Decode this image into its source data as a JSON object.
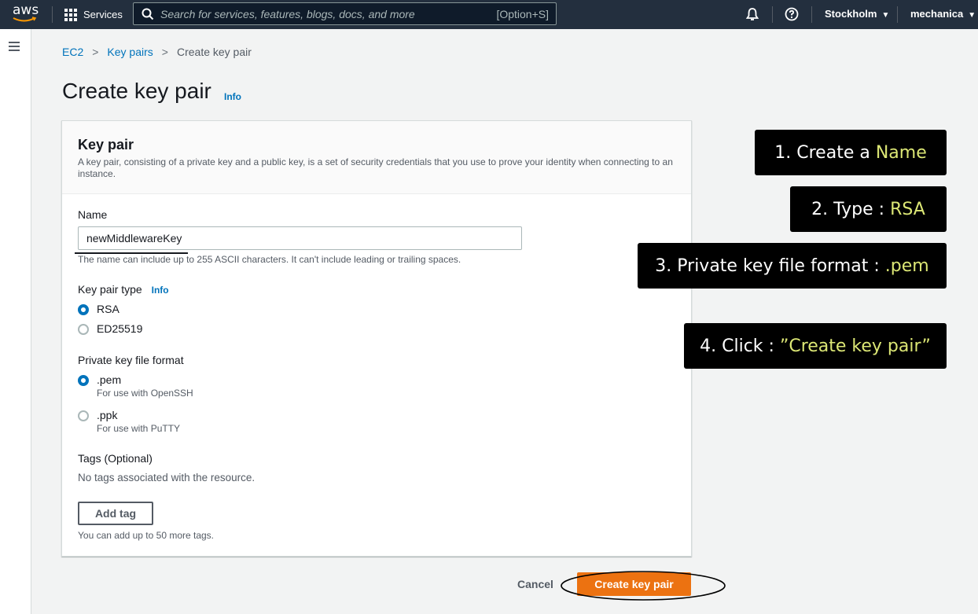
{
  "topnav": {
    "logo": "aws",
    "services_label": "Services",
    "search_placeholder": "Search for services, features, blogs, docs, and more",
    "search_shortcut": "[Option+S]",
    "region": "Stockholm",
    "account": "mechanica",
    "icons": [
      "grid-icon",
      "search-icon",
      "bell-icon",
      "help-icon",
      "caret-down-icon"
    ]
  },
  "breadcrumb": [
    "EC2",
    "Key pairs",
    "Create key pair"
  ],
  "page": {
    "title": "Create key pair",
    "info": "Info"
  },
  "panel": {
    "title": "Key pair",
    "description": "A key pair, consisting of a private key and a public key, is a set of security credentials that you use to prove your identity when connecting to an instance.",
    "name_label": "Name",
    "name_value": "newMiddlewareKey",
    "name_hint": "The name can include up to 255 ASCII characters. It can't include leading or trailing spaces.",
    "type_label": "Key pair type",
    "type_info": "Info",
    "type_options": [
      {
        "label": "RSA",
        "selected": true
      },
      {
        "label": "ED25519",
        "selected": false
      }
    ],
    "format_label": "Private key file format",
    "format_options": [
      {
        "label": ".pem",
        "sub": "For use with OpenSSH",
        "selected": true
      },
      {
        "label": ".ppk",
        "sub": "For use with PuTTY",
        "selected": false
      }
    ],
    "tags_label": "Tags (Optional)",
    "tags_empty": "No tags associated with the resource.",
    "add_tag": "Add tag",
    "tags_hint": "You can add up to 50 more tags."
  },
  "actions": {
    "cancel": "Cancel",
    "create": "Create key pair"
  },
  "callouts": [
    {
      "prefix": "1. Create a ",
      "highlight": "Name"
    },
    {
      "prefix": "2. Type : ",
      "highlight": "RSA"
    },
    {
      "prefix": "3. Private key file format : ",
      "highlight": ".pem"
    },
    {
      "prefix": "4. Click : ",
      "highlight": "”Create key pair”"
    }
  ],
  "colors": {
    "nav_bg": "#232f3e",
    "link": "#0073bb",
    "primary_button": "#ec7211",
    "callout_bg": "#000000",
    "callout_highlight": "#dce775"
  }
}
